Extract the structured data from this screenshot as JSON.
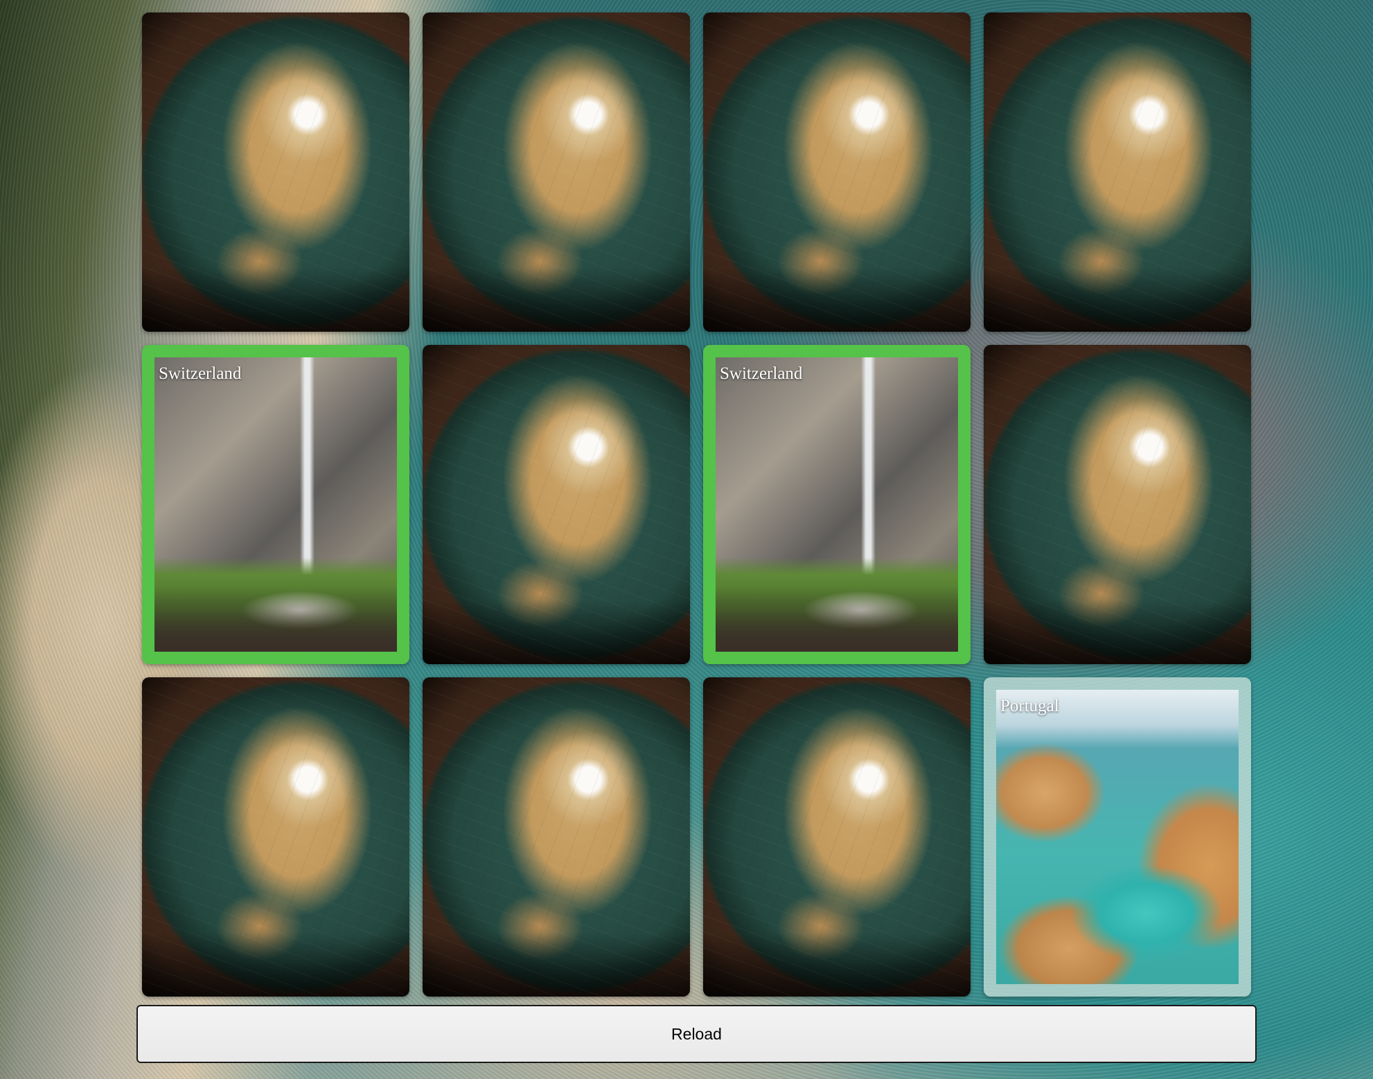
{
  "game": {
    "cards": [
      {
        "state": "back",
        "label": ""
      },
      {
        "state": "back",
        "label": ""
      },
      {
        "state": "back",
        "label": ""
      },
      {
        "state": "back",
        "label": ""
      },
      {
        "state": "matched",
        "label": "Switzerland",
        "image": "waterfall-village-photo"
      },
      {
        "state": "back",
        "label": ""
      },
      {
        "state": "matched",
        "label": "Switzerland",
        "image": "waterfall-village-photo"
      },
      {
        "state": "back",
        "label": ""
      },
      {
        "state": "back",
        "label": ""
      },
      {
        "state": "back",
        "label": ""
      },
      {
        "state": "back",
        "label": ""
      },
      {
        "state": "open",
        "label": "Portugal",
        "image": "coastal-cliffs-photo"
      }
    ],
    "card_back_image": "vintage-globe",
    "background_image": "aerial-coastline",
    "colors": {
      "matched_border": "#55c24a",
      "open_border": "#cde1dc"
    }
  },
  "controls": {
    "reload_label": "Reload"
  }
}
